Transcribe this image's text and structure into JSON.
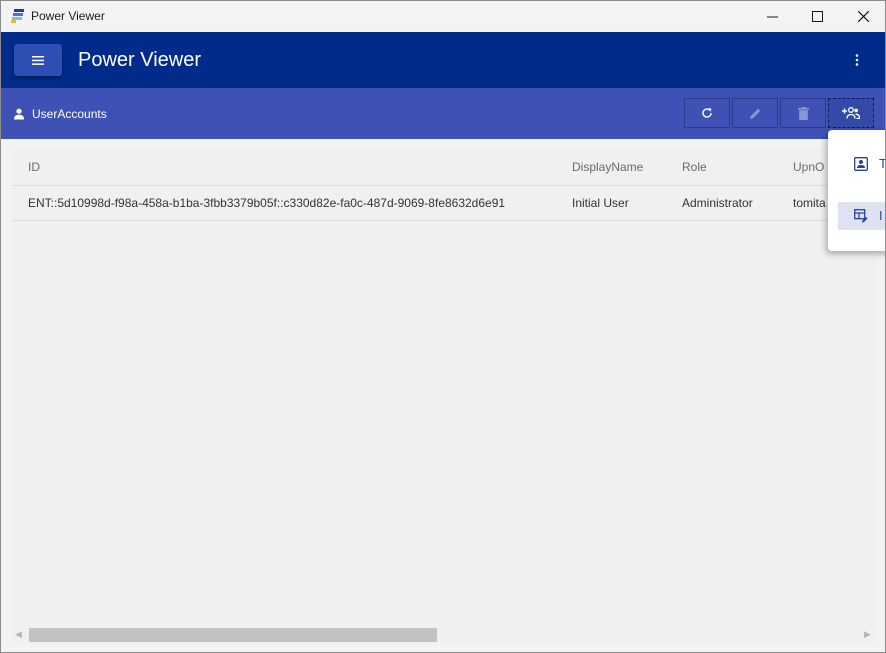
{
  "window": {
    "title": "Power Viewer",
    "minimize_glyph": "—",
    "maximize_glyph": "□",
    "close_glyph": "✕"
  },
  "appbar": {
    "title": "Power Viewer",
    "icons": [
      "hamburger-menu-icon",
      "more-vertical-icon"
    ]
  },
  "toolbar": {
    "page_label": "UserAccounts",
    "buttons": [
      {
        "name": "refresh",
        "icon": "refresh-icon",
        "enabled": true
      },
      {
        "name": "edit",
        "icon": "pencil-icon",
        "enabled": false
      },
      {
        "name": "delete",
        "icon": "trash-icon",
        "enabled": false
      },
      {
        "name": "add-user",
        "icon": "add-group-icon",
        "enabled": true,
        "active": true
      }
    ]
  },
  "grid": {
    "columns": [
      "ID",
      "DisplayName",
      "Role",
      "UpnO"
    ],
    "rows": [
      {
        "id": "ENT::5d10998d-f98a-458a-b1ba-3fbb3379b05f::c330d82e-fa0c-487d-9069-8fe8632d6e91",
        "display_name": "Initial User",
        "role": "Administrator",
        "upn": "tomita"
      }
    ]
  },
  "popup_menu": {
    "items": [
      {
        "label": "T",
        "icon": "import-user-icon",
        "selected": false
      },
      {
        "label": "I",
        "icon": "table-edit-icon",
        "selected": true
      }
    ]
  },
  "colors": {
    "appbar": "#002b8a",
    "toolbar": "#3f51b5",
    "accent_text": "#2d3f9e"
  }
}
